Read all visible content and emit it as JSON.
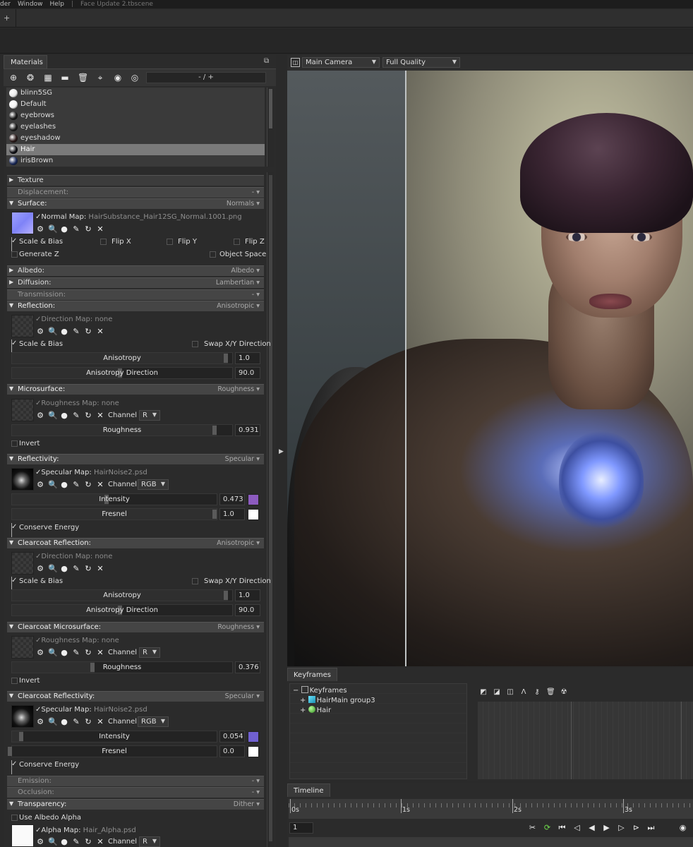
{
  "menubar": {
    "items": [
      "der",
      "Window",
      "Help"
    ],
    "separator": "|",
    "file_title": "Face Update 2.tbscene"
  },
  "tabbar": {
    "add_label": "+"
  },
  "materials_panel": {
    "tab_label": "Materials",
    "toolbar_icons": [
      "add-material-icon",
      "duplicate-icon",
      "checker-icon",
      "folder-icon",
      "trash-icon",
      "picker-icon",
      "record-icon",
      "link-icon"
    ],
    "zoom_field": "- / +",
    "materials": [
      {
        "name": "blinn5SG",
        "color": "#e9e9e9"
      },
      {
        "name": "Default",
        "color": "#f2f2f2"
      },
      {
        "name": "eyebrows",
        "color": "#1a1a1a"
      },
      {
        "name": "eyelashes",
        "color": "#1d1d1d"
      },
      {
        "name": "eyeshadow",
        "color": "#2a1a1a"
      },
      {
        "name": "Hair",
        "color": "#0f0f14",
        "selected": true
      },
      {
        "name": "irisBrown",
        "color": "#1b2a5a"
      }
    ]
  },
  "sections": {
    "texture": {
      "label": "Texture"
    },
    "displacement": {
      "label": "Displacement:",
      "value": "-"
    },
    "surface": {
      "label": "Surface:",
      "value": "Normals",
      "normal_map_label": "Normal Map:",
      "normal_map_file": "HairSubstance_Hair12SG_Normal.1001.png",
      "scale_bias": "Scale & Bias",
      "flip_x": "Flip X",
      "flip_y": "Flip Y",
      "flip_z": "Flip Z",
      "generate_z": "Generate Z",
      "object_space": "Object Space"
    },
    "albedo": {
      "label": "Albedo:",
      "value": "Albedo"
    },
    "diffusion": {
      "label": "Diffusion:",
      "value": "Lambertian"
    },
    "transmission": {
      "label": "Transmission:",
      "value": "-"
    },
    "reflection": {
      "label": "Reflection:",
      "value": "Anisotropic",
      "direction_map_label": "Direction Map:",
      "direction_map_file": "none",
      "scale_bias": "Scale & Bias",
      "swap_xy": "Swap X/Y Direction",
      "anisotropy_label": "Anisotropy",
      "anisotropy_value": "1.0",
      "anisotropy_level": 0.98,
      "direction_label": "Anisotropy Direction",
      "direction_value": "90.0",
      "direction_level": 0.5
    },
    "microsurface": {
      "label": "Microsurface:",
      "value": "Roughness",
      "roughness_map_label": "Roughness Map:",
      "roughness_map_file": "none",
      "channel_label": "Channel",
      "channel_value": "R",
      "roughness_label": "Roughness",
      "roughness_value": "0.931",
      "roughness_level": 0.931,
      "invert": "Invert"
    },
    "reflectivity": {
      "label": "Reflectivity:",
      "value": "Specular",
      "specular_map_label": "Specular Map:",
      "specular_map_file": "HairNoise2.psd",
      "channel_label": "Channel",
      "channel_value": "RGB",
      "intensity_label": "Intensity",
      "intensity_value": "0.473",
      "intensity_level": 0.473,
      "intensity_color": "#8c5bbf",
      "fresnel_label": "Fresnel",
      "fresnel_value": "1.0",
      "fresnel_level": 1.0,
      "fresnel_color": "#ffffff",
      "conserve": "Conserve Energy"
    },
    "clearcoat_reflection": {
      "label": "Clearcoat Reflection:",
      "value": "Anisotropic",
      "direction_map_label": "Direction Map:",
      "direction_map_file": "none",
      "scale_bias": "Scale & Bias",
      "swap_xy": "Swap X/Y Direction",
      "anisotropy_label": "Anisotropy",
      "anisotropy_value": "1.0",
      "anisotropy_level": 0.98,
      "direction_label": "Anisotropy Direction",
      "direction_value": "90.0",
      "direction_level": 0.5
    },
    "clearcoat_microsurface": {
      "label": "Clearcoat Microsurface:",
      "value": "Roughness",
      "roughness_map_label": "Roughness Map:",
      "roughness_map_file": "none",
      "channel_label": "Channel",
      "channel_value": "R",
      "roughness_label": "Roughness",
      "roughness_value": "0.376",
      "roughness_level": 0.376,
      "invert": "Invert"
    },
    "clearcoat_reflectivity": {
      "label": "Clearcoat Reflectivity:",
      "value": "Specular",
      "specular_map_label": "Specular Map:",
      "specular_map_file": "HairNoise2.psd",
      "channel_label": "Channel",
      "channel_value": "RGB",
      "intensity_label": "Intensity",
      "intensity_value": "0.054",
      "intensity_level": 0.054,
      "intensity_color": "#7060d0",
      "fresnel_label": "Fresnel",
      "fresnel_value": "0.0",
      "fresnel_level": 0.0,
      "fresnel_color": "#ffffff",
      "conserve": "Conserve Energy"
    },
    "emission": {
      "label": "Emission:",
      "value": "-"
    },
    "occlusion": {
      "label": "Occlusion:",
      "value": "-"
    },
    "transparency": {
      "label": "Transparency:",
      "value": "Dither",
      "use_albedo_alpha": "Use Albedo Alpha",
      "alpha_map_label": "Alpha Map:",
      "alpha_map_file": "Hair_Alpha.psd",
      "channel_label": "Channel",
      "channel_value": "R"
    }
  },
  "viewport": {
    "camera": "Main Camera",
    "quality": "Full Quality"
  },
  "keyframes": {
    "tab_label": "Keyframes",
    "tree": [
      {
        "label": "Keyframes",
        "indent": 0,
        "icon": "keyframes-icon"
      },
      {
        "label": "HairMain group3",
        "indent": 1,
        "icon": "cube-icon"
      },
      {
        "label": "Hair",
        "indent": 1,
        "icon": "sphere-icon"
      }
    ],
    "track_icons": [
      "key-linear-icon",
      "curve-icon",
      "step-icon",
      "peak-icon",
      "key-icon",
      "trash-icon",
      "radiation-icon"
    ]
  },
  "timeline": {
    "tab_label": "Timeline",
    "ticks": [
      "0s",
      "1s",
      "2s",
      "3s"
    ],
    "frame": "1",
    "controls": [
      "scissors-icon",
      "loop-icon",
      "skip-start-icon",
      "prev-key-icon",
      "step-back-icon",
      "play-icon",
      "step-forward-icon",
      "next-key-icon",
      "skip-end-icon",
      "settings-icon"
    ]
  },
  "colors": {
    "selected_row": "#7a7a7a",
    "panel_bg": "#2b2b2b",
    "section_header": "#454545"
  }
}
